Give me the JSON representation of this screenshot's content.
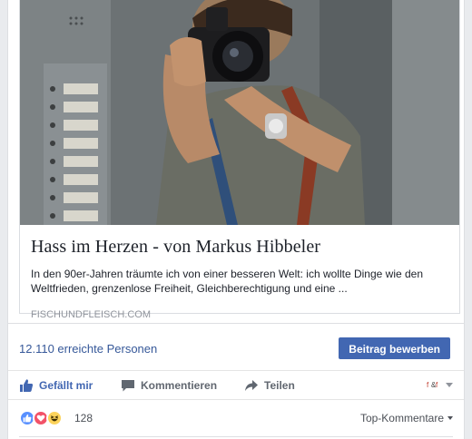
{
  "attachment": {
    "title": "Hass im Herzen - von Markus Hibbeler",
    "description": "In den 90er-Jahren träumte ich von einer besseren Welt: ich wollte Dinge wie den Weltfrieden, grenzenlose Freiheit, Gleichberechtigung und eine ...",
    "domain": "FISCHUNDFLEISCH.COM",
    "image_icon": "photo-thumbnail"
  },
  "reach": {
    "count_text": "12.110 erreichte Personen",
    "boost_label": "Beitrag bewerben"
  },
  "actions": {
    "like_label": "Gefällt mir",
    "comment_label": "Kommentieren",
    "share_label": "Teilen"
  },
  "reactions": {
    "icons": [
      "like-icon",
      "love-icon",
      "haha-icon"
    ],
    "count": "128",
    "sort_label": "Top-Kommentare"
  },
  "colors": {
    "accent": "#4267b2",
    "link": "#365899",
    "muted": "#90949c"
  }
}
